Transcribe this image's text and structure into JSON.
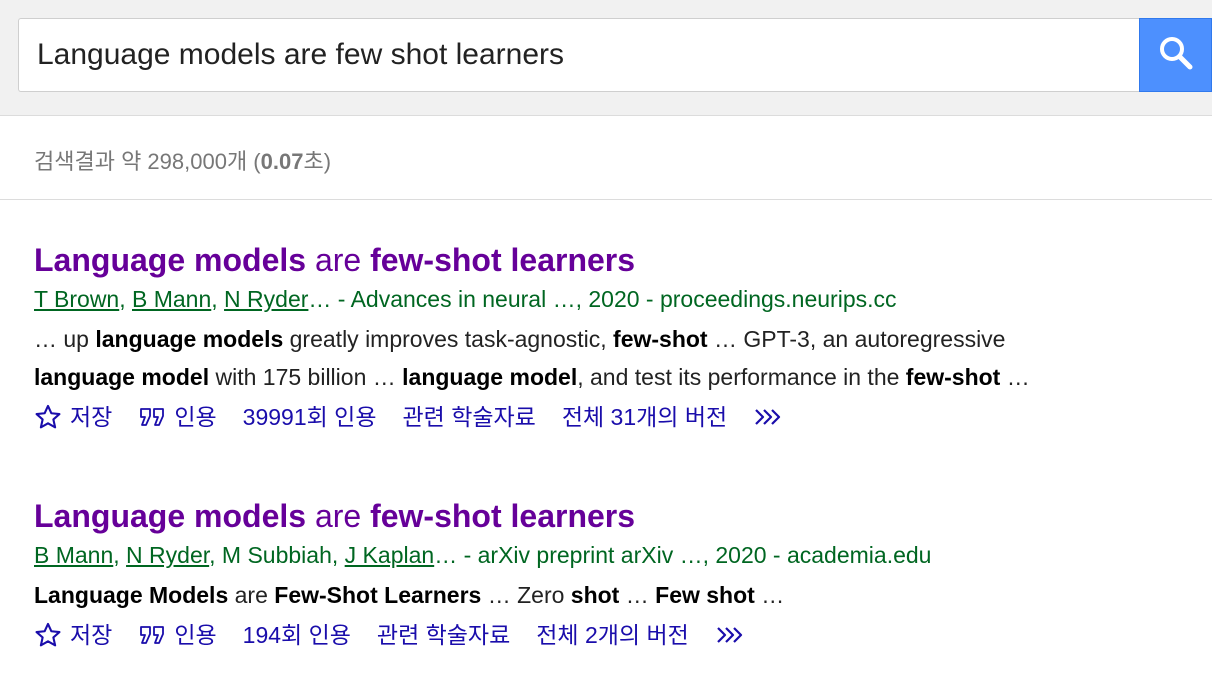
{
  "search": {
    "query": "Language models are few shot learners"
  },
  "stats": {
    "prefix": "검색결과 약 298,000개 (",
    "time": "0.07",
    "suffix": "초)"
  },
  "results": [
    {
      "title": {
        "part1": "Language models",
        "part2": " are ",
        "part3": "few-shot learners"
      },
      "authors": [
        "T Brown",
        "B Mann",
        "N Ryder"
      ],
      "source": "… - Advances in neural …, 2020 - proceedings.neurips.cc",
      "snippet_line1": [
        {
          "t": "… up ",
          "b": false
        },
        {
          "t": "language models",
          "b": true
        },
        {
          "t": " greatly improves task-agnostic, ",
          "b": false
        },
        {
          "t": "few-shot",
          "b": true
        },
        {
          "t": " … GPT-3, an autoregressive",
          "b": false
        }
      ],
      "snippet_line2": [
        {
          "t": "language model",
          "b": true
        },
        {
          "t": " with 175 billion … ",
          "b": false
        },
        {
          "t": "language model",
          "b": true
        },
        {
          "t": ", and test its performance in the ",
          "b": false
        },
        {
          "t": "few-shot",
          "b": true
        },
        {
          "t": " …",
          "b": false
        }
      ],
      "actions": {
        "save": "저장",
        "cite": "인용",
        "cited_by": "39991회 인용",
        "related": "관련 학술자료",
        "versions": "전체 31개의 버전"
      }
    },
    {
      "title": {
        "part1": "Language models",
        "part2": " are ",
        "part3": "few-shot learners"
      },
      "authors_plain": "M Subbiah",
      "authors": [
        "B Mann",
        "N Ryder",
        "J Kaplan"
      ],
      "source": "… - arXiv preprint arXiv …, 2020 - academia.edu",
      "snippet_line1": [
        {
          "t": "Language Models",
          "b": true
        },
        {
          "t": " are ",
          "b": false
        },
        {
          "t": "Few-Shot Learners",
          "b": true
        },
        {
          "t": " … Zero ",
          "b": false
        },
        {
          "t": "shot",
          "b": true
        },
        {
          "t": " … ",
          "b": false
        },
        {
          "t": "Few shot",
          "b": true
        },
        {
          "t": " …",
          "b": false
        }
      ],
      "actions": {
        "save": "저장",
        "cite": "인용",
        "cited_by": "194회 인용",
        "related": "관련 학술자료",
        "versions": "전체 2개의 버전"
      }
    }
  ],
  "colors": {
    "title": "#660099",
    "meta": "#006621",
    "action": "#1a0dab",
    "search_button": "#4d90fe"
  },
  "icons": [
    "search-icon",
    "star-icon",
    "quote-icon",
    "double-chevron-icon"
  ]
}
